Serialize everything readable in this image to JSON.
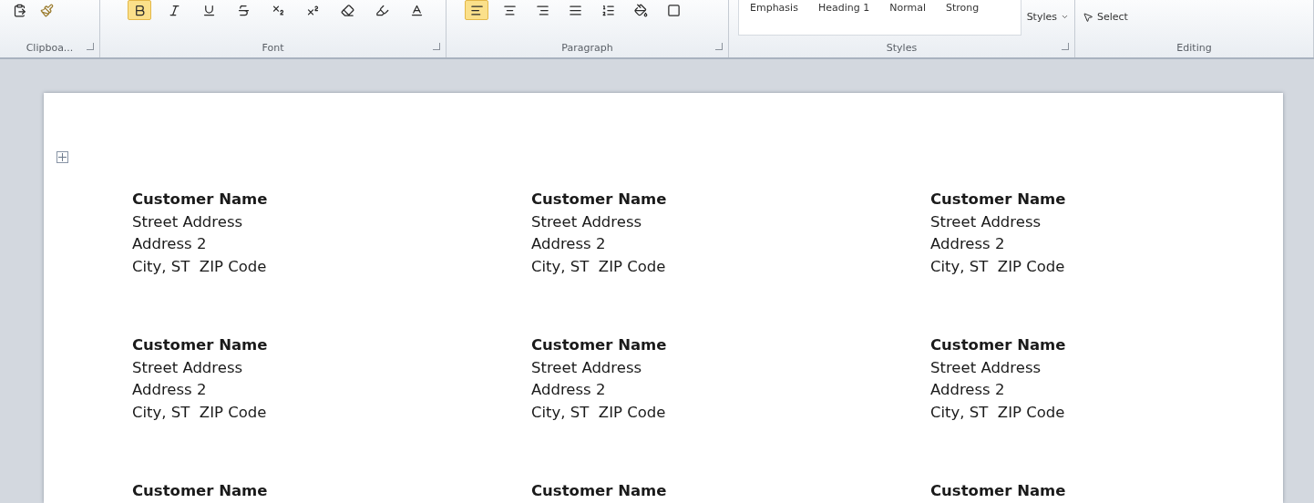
{
  "ribbon": {
    "groups": [
      {
        "kind": "clipboard",
        "label": "Clipboa...",
        "launcher": true
      },
      {
        "kind": "font",
        "label": "Font",
        "launcher": true,
        "buttons": [
          {
            "selected": true
          },
          {
            "selected": false
          },
          {
            "selected": false
          },
          {
            "selected": false
          },
          {
            "selected": false
          },
          {
            "selected": false
          },
          {
            "selected": false
          },
          {
            "selected": false
          },
          {
            "selected": false
          }
        ]
      },
      {
        "kind": "paragraph",
        "label": "Paragraph",
        "launcher": true,
        "buttons": [
          {
            "selected": true
          },
          {
            "selected": false
          },
          {
            "selected": false
          },
          {
            "selected": false
          },
          {
            "selected": false
          },
          {
            "selected": false
          },
          {
            "selected": false
          }
        ]
      },
      {
        "kind": "styles",
        "label": "Styles",
        "launcher": true,
        "gallery": [
          "Emphasis",
          "Heading 1",
          "Normal",
          "Strong"
        ],
        "change_styles": "Styles"
      },
      {
        "kind": "editing",
        "label": "Editing",
        "select": "Select"
      }
    ]
  },
  "document": {
    "labels": [
      {
        "lines": [
          "Customer Name",
          "Street Address",
          "Address 2",
          "City, ST  ZIP Code"
        ]
      },
      {
        "lines": [
          "Customer Name",
          "Street Address",
          "Address 2",
          "City, ST  ZIP Code"
        ]
      },
      {
        "lines": [
          "Customer Name",
          "Street Address",
          "Address 2",
          "City, ST  ZIP Code"
        ]
      },
      {
        "lines": [
          "Customer Name",
          "Street Address",
          "Address 2",
          "City, ST  ZIP Code"
        ]
      },
      {
        "lines": [
          "Customer Name",
          "Street Address",
          "Address 2",
          "City, ST  ZIP Code"
        ]
      },
      {
        "lines": [
          "Customer Name",
          "Street Address",
          "Address 2",
          "City, ST  ZIP Code"
        ]
      },
      {
        "lines": [
          "Customer Name"
        ]
      },
      {
        "lines": [
          "Customer Name"
        ]
      },
      {
        "lines": [
          "Customer Name"
        ]
      }
    ]
  }
}
